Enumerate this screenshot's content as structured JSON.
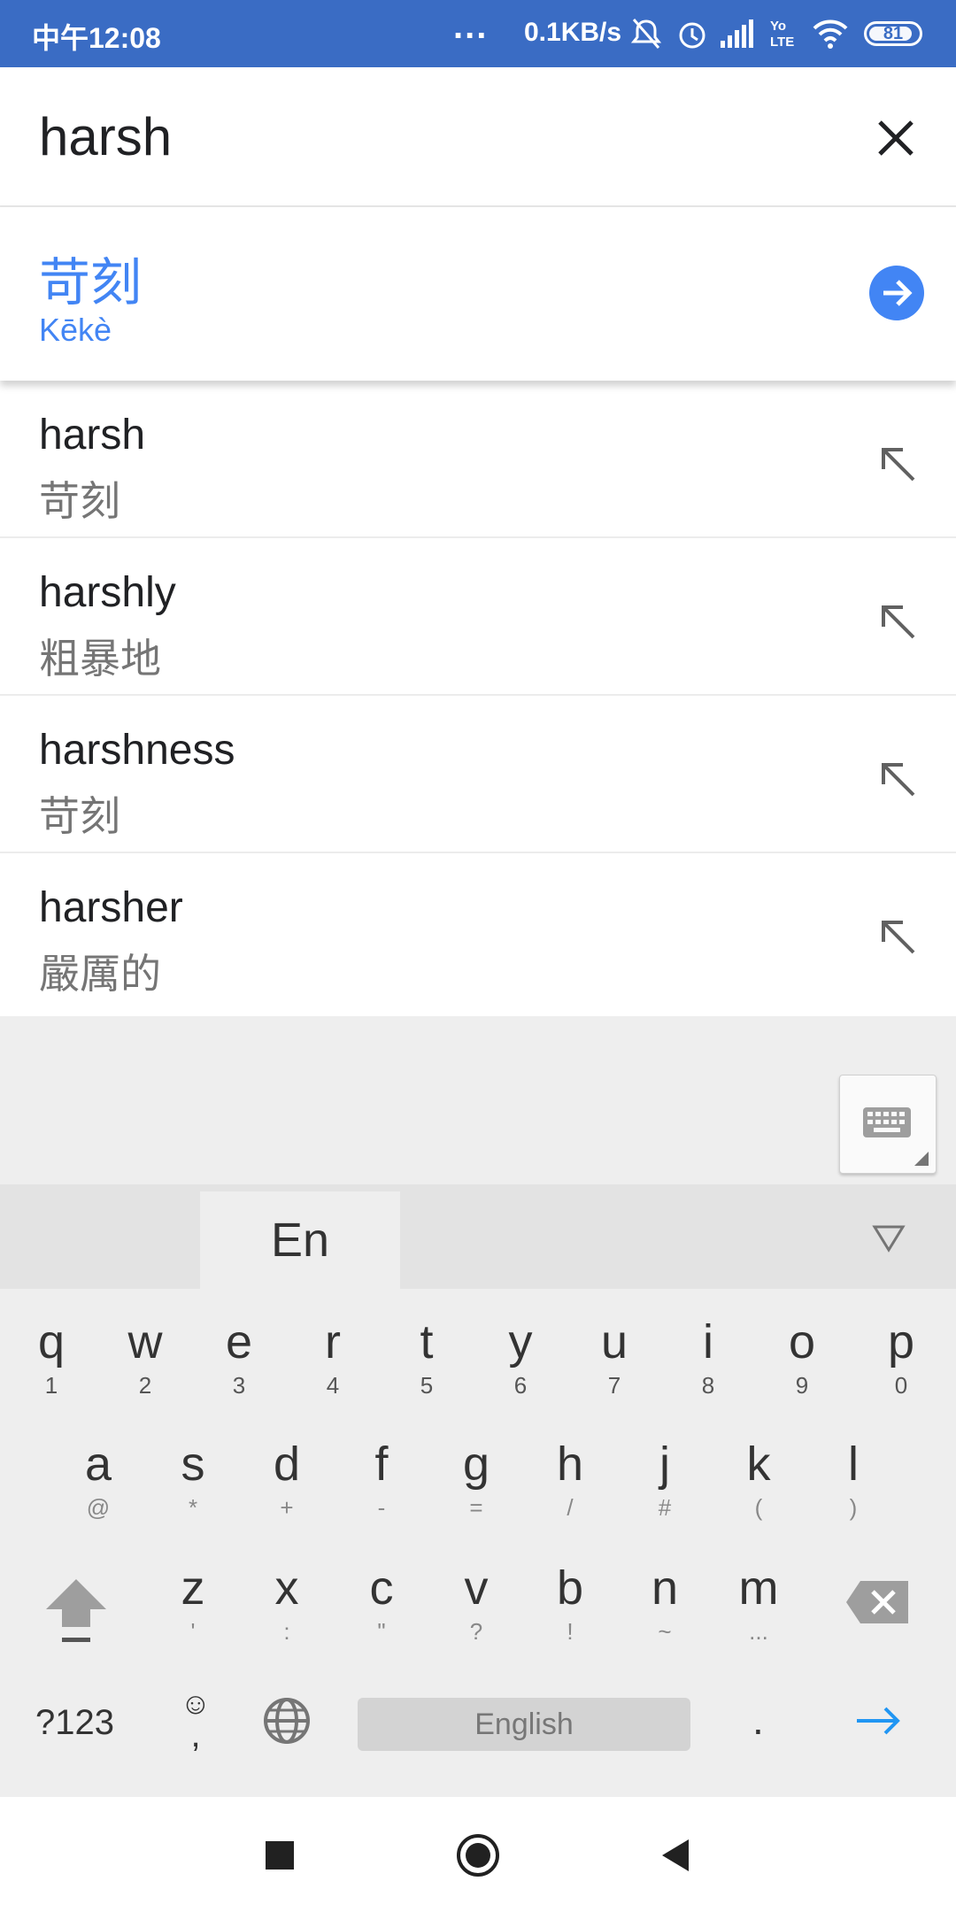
{
  "status_bar": {
    "time": "中午12:08",
    "dots": "...",
    "net_speed": "0.1KB/s",
    "battery": "81",
    "icons": [
      "mute-icon",
      "alarm-icon",
      "signal-icon",
      "volte-icon",
      "wifi-icon",
      "battery-icon"
    ]
  },
  "search": {
    "query": "harsh"
  },
  "result": {
    "translation": "苛刻",
    "pinyin": "Kēkè"
  },
  "suggestions": [
    {
      "word": "harsh",
      "translation": "苛刻"
    },
    {
      "word": "harshly",
      "translation": "粗暴地"
    },
    {
      "word": "harshness",
      "translation": "苛刻"
    },
    {
      "word": "harsher",
      "translation": "嚴厲的"
    }
  ],
  "keyboard": {
    "language_tab": "En",
    "row1": [
      {
        "k": "q",
        "s": "1"
      },
      {
        "k": "w",
        "s": "2"
      },
      {
        "k": "e",
        "s": "3"
      },
      {
        "k": "r",
        "s": "4"
      },
      {
        "k": "t",
        "s": "5"
      },
      {
        "k": "y",
        "s": "6"
      },
      {
        "k": "u",
        "s": "7"
      },
      {
        "k": "i",
        "s": "8"
      },
      {
        "k": "o",
        "s": "9"
      },
      {
        "k": "p",
        "s": "0"
      }
    ],
    "row2": [
      {
        "k": "a",
        "s": "@"
      },
      {
        "k": "s",
        "s": "*"
      },
      {
        "k": "d",
        "s": "+"
      },
      {
        "k": "f",
        "s": "-"
      },
      {
        "k": "g",
        "s": "="
      },
      {
        "k": "h",
        "s": "/"
      },
      {
        "k": "j",
        "s": "#"
      },
      {
        "k": "k",
        "s": "("
      },
      {
        "k": "l",
        "s": ")"
      }
    ],
    "row3": [
      {
        "k": "z",
        "s": "'"
      },
      {
        "k": "x",
        "s": ":"
      },
      {
        "k": "c",
        "s": "\""
      },
      {
        "k": "v",
        "s": "?"
      },
      {
        "k": "b",
        "s": "!"
      },
      {
        "k": "n",
        "s": "~"
      },
      {
        "k": "m",
        "s": "..."
      }
    ],
    "symbols_key": "?123",
    "emoji_key": "☺",
    "comma": ",",
    "space_label": "English",
    "period": "."
  },
  "colors": {
    "status_bar": "#3a6cc4",
    "accent": "#4285f4",
    "enter_arrow": "#2196f3"
  }
}
